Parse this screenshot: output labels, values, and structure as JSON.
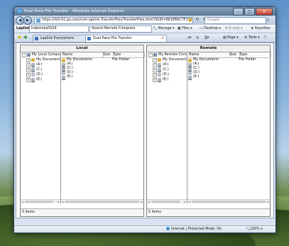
{
  "window": {
    "title": "Dual Pane File Transfer - Windows Internet Explorer"
  },
  "address": {
    "url": "https://lls5-02.go.com/com.laplink.TransferFiles/TransferFiles.html?SSID=881EB6C7F31B",
    "search_placeholder": "Google"
  },
  "links_bar": {
    "brand": "Laplink",
    "user": "lcaboroka0104",
    "remote_dropdown": "Search Remote Computer",
    "manage": "Manage",
    "files": "Files",
    "desktop": "Desktop",
    "email": "E-mail",
    "favorites": "Favorites"
  },
  "tabs": [
    {
      "label": "Laplink Everywhere"
    },
    {
      "label": "Dual Pane File Transfer"
    }
  ],
  "toolbar": {
    "page": "Page",
    "tools": "Tools"
  },
  "panes": {
    "left": {
      "title": "Local",
      "tree": [
        {
          "label": "My Local Compute",
          "level": 0,
          "icon": "pc",
          "expand": "-"
        },
        {
          "label": "My Documents",
          "level": 1,
          "icon": "folder",
          "expand": "+"
        },
        {
          "label": "(A:)",
          "level": 1,
          "icon": "drive",
          "expand": "+"
        },
        {
          "label": "(C:)",
          "level": 1,
          "icon": "drive",
          "expand": "+"
        },
        {
          "label": "(D:)",
          "level": 1,
          "icon": "cd",
          "expand": "+"
        },
        {
          "label": "(E:)",
          "level": 1,
          "icon": "drive",
          "expand": "+"
        }
      ],
      "columns": [
        "Name",
        "Size",
        "Type"
      ],
      "rows": [
        {
          "name": "My Documents",
          "size": "",
          "type": "File Folder",
          "icon": "folder"
        },
        {
          "name": "(A:)",
          "size": "",
          "type": "",
          "icon": "drive"
        },
        {
          "name": "(C:)",
          "size": "",
          "type": "",
          "icon": "drive"
        },
        {
          "name": "(D:)",
          "size": "",
          "type": "",
          "icon": "cd"
        },
        {
          "name": "(E:)",
          "size": "",
          "type": "",
          "icon": "drive"
        }
      ],
      "status": "5 items"
    },
    "right": {
      "title": "Remote",
      "tree": [
        {
          "label": "My Remote Comp",
          "level": 0,
          "icon": "pc",
          "expand": "-"
        },
        {
          "label": "My Documents",
          "level": 1,
          "icon": "folder",
          "expand": "+"
        },
        {
          "label": "(A:)",
          "level": 1,
          "icon": "drive",
          "expand": "+"
        },
        {
          "label": "(C:)",
          "level": 1,
          "icon": "drive",
          "expand": "+"
        },
        {
          "label": "(D:)",
          "level": 1,
          "icon": "cd",
          "expand": "+"
        },
        {
          "label": "(E:)",
          "level": 1,
          "icon": "drive",
          "expand": "+"
        }
      ],
      "columns": [
        "Name",
        "Size",
        "Type"
      ],
      "rows": [
        {
          "name": "My Documents",
          "size": "",
          "type": "File Folder",
          "icon": "folder"
        },
        {
          "name": "(A:)",
          "size": "",
          "type": "",
          "icon": "drive"
        },
        {
          "name": "(C:)",
          "size": "",
          "type": "",
          "icon": "drive"
        },
        {
          "name": "(D:)",
          "size": "",
          "type": "",
          "icon": "cd"
        },
        {
          "name": "(E:)",
          "size": "",
          "type": "",
          "icon": "drive"
        }
      ],
      "status": "5 items"
    }
  },
  "status_bar": {
    "zone": "Internet | Protected Mode: On",
    "zoom": "100%"
  }
}
